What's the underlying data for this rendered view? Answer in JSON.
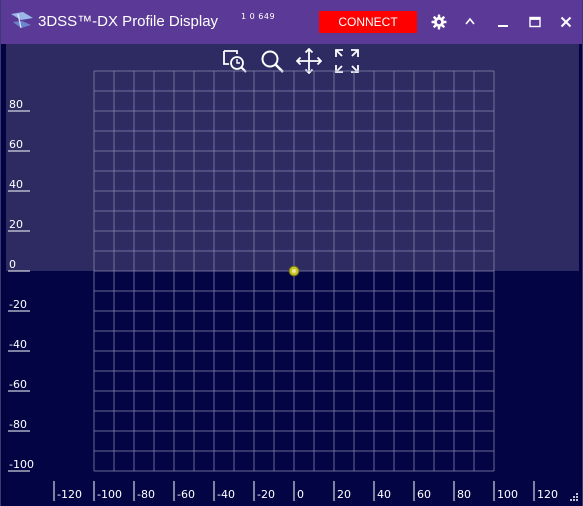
{
  "window": {
    "title": "3DSS™-DX Profile Display",
    "version": "1 0 649",
    "connect_label": "CONNECT"
  },
  "titlebar_icons": [
    "app-logo-icon",
    "gear-icon",
    "caret-up-icon",
    "minimize-icon",
    "maximize-icon",
    "close-icon"
  ],
  "toolbar_icons": [
    "zoom-reset-icon",
    "zoom-icon",
    "pan-icon",
    "fit-icon"
  ],
  "colors": {
    "titlebar": "#5b3a97",
    "connect": "#ff0000",
    "upper_band": "#2e2b62",
    "lower_band": "#020443",
    "grid": "#8a8ab0",
    "marker": "#c8c420"
  },
  "chart_data": {
    "type": "scatter",
    "xlim": [
      -100,
      100
    ],
    "ylim": [
      -100,
      100
    ],
    "grid": true,
    "x_tick_labels": [
      "-120",
      "-100",
      "-80",
      "-60",
      "-40",
      "-20",
      "0",
      "20",
      "40",
      "60",
      "80",
      "100",
      "120"
    ],
    "x_ticks": [
      -120,
      -100,
      -80,
      -60,
      -40,
      -20,
      0,
      20,
      40,
      60,
      80,
      100,
      120
    ],
    "y_tick_labels": [
      "80",
      "60",
      "40",
      "20",
      "0",
      "-20",
      "-40",
      "-60",
      "-80",
      "-100"
    ],
    "y_ticks": [
      80,
      60,
      40,
      20,
      0,
      -20,
      -40,
      -60,
      -80,
      -100
    ],
    "points": [
      {
        "x": 0,
        "y": 0
      }
    ]
  }
}
